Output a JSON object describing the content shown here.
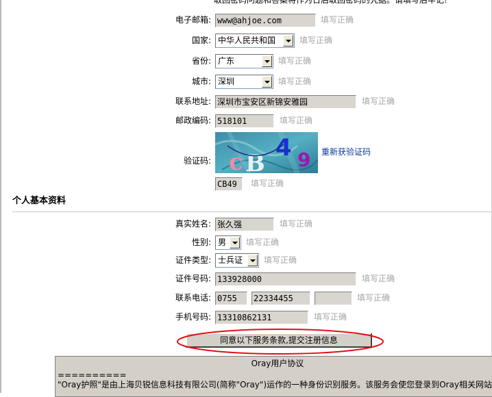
{
  "top_notice": "取回密码问题和答案将作为日后取回密码的凭据。请填写后牢记!",
  "hint": "填写正确",
  "contact": {
    "email_label": "电子邮箱:",
    "email_value": "www@ahjoe.com",
    "country_label": "国家:",
    "country_value": "中华人民共和国",
    "province_label": "省份:",
    "province_value": "广东",
    "city_label": "城市:",
    "city_value": "深圳",
    "address_label": "联系地址:",
    "address_value": "深圳市宝安区新锦安雅园",
    "postcode_label": "邮政编码:",
    "postcode_value": "518101",
    "captcha_label": "验证码:",
    "captcha_chars": [
      "c",
      "B",
      "4",
      "9"
    ],
    "captcha_refresh": "重新获验证码",
    "captcha_value": "CB49"
  },
  "personal": {
    "section_title": "个人基本资料",
    "realname_label": "真实姓名:",
    "realname_value": "张久强",
    "gender_label": "性别:",
    "gender_value": "男",
    "idtype_label": "证件类型:",
    "idtype_value": "士兵证",
    "idnum_label": "证件号码:",
    "idnum_value": "133928000",
    "phone_label": "联系电话:",
    "phone_area": "0755",
    "phone_number": "22334455",
    "phone_ext": "",
    "mobile_label": "手机号码:",
    "mobile_value": "13310862131"
  },
  "submit_label": "同意以下服务条款,提交注册信息",
  "agreement": {
    "title": "Oray用户协议",
    "line1": "==========",
    "line2": "\"Oray护照\"是由上海贝锐信息科技有限公司(简称\"Oray\")运作的一种身份识别服务。该服务会使您登录到Oray相关网站"
  },
  "colors": {
    "input_bg": "#d9d5cf",
    "hint_text": "#a6a6a6",
    "link": "#0a3a99",
    "highlight_ellipse": "#e01010"
  }
}
